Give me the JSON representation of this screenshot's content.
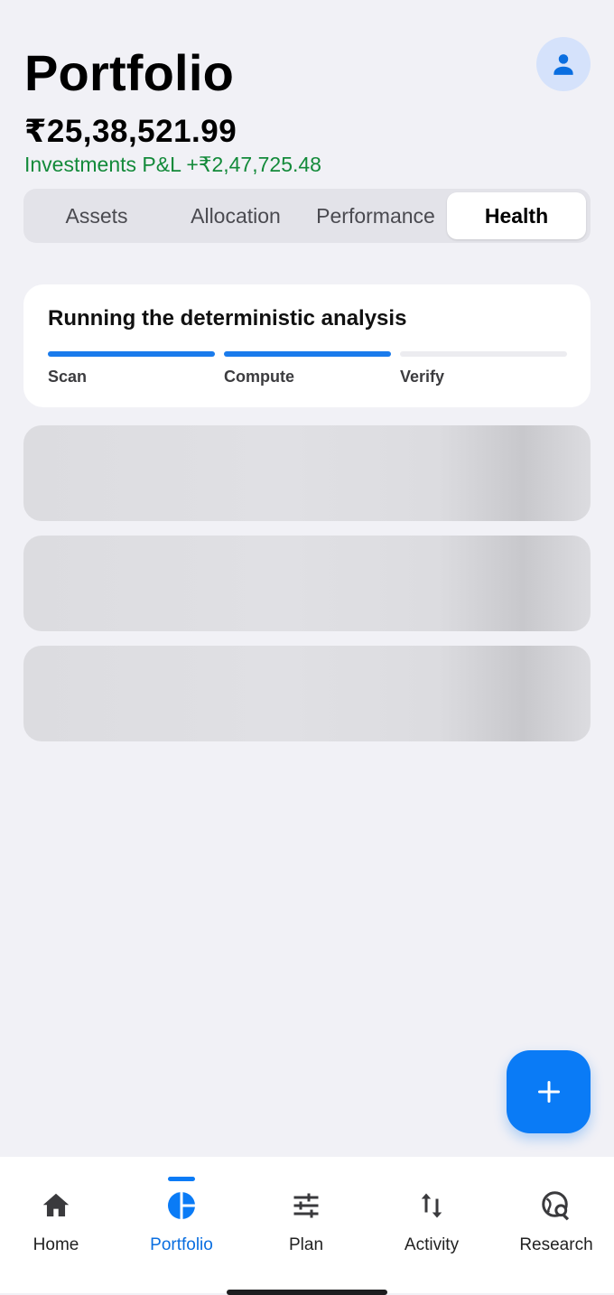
{
  "header": {
    "title": "Portfolio",
    "total_value": "₹25,38,521.99",
    "pnl": "Investments P&L +₹2,47,725.48",
    "avatar_icon": "person-icon"
  },
  "tabs": [
    {
      "label": "Assets",
      "active": false
    },
    {
      "label": "Allocation",
      "active": false
    },
    {
      "label": "Performance",
      "active": false
    },
    {
      "label": "Health",
      "active": true
    }
  ],
  "analysis": {
    "title": "Running the deterministic analysis",
    "steps": [
      {
        "label": "Scan",
        "progress": 1.0
      },
      {
        "label": "Compute",
        "progress": 1.0
      },
      {
        "label": "Verify",
        "progress": 0.0
      }
    ]
  },
  "skeleton_count": 3,
  "fab": {
    "icon": "plus-icon"
  },
  "bottom_nav": [
    {
      "label": "Home",
      "icon": "home-icon",
      "active": false
    },
    {
      "label": "Portfolio",
      "icon": "pie-chart-icon",
      "active": true
    },
    {
      "label": "Plan",
      "icon": "sliders-icon",
      "active": false
    },
    {
      "label": "Activity",
      "icon": "up-down-arrows-icon",
      "active": false
    },
    {
      "label": "Research",
      "icon": "globe-search-icon",
      "active": false
    }
  ],
  "colors": {
    "accent": "#0a7bf6",
    "positive": "#138a3a",
    "background": "#f1f1f6"
  }
}
